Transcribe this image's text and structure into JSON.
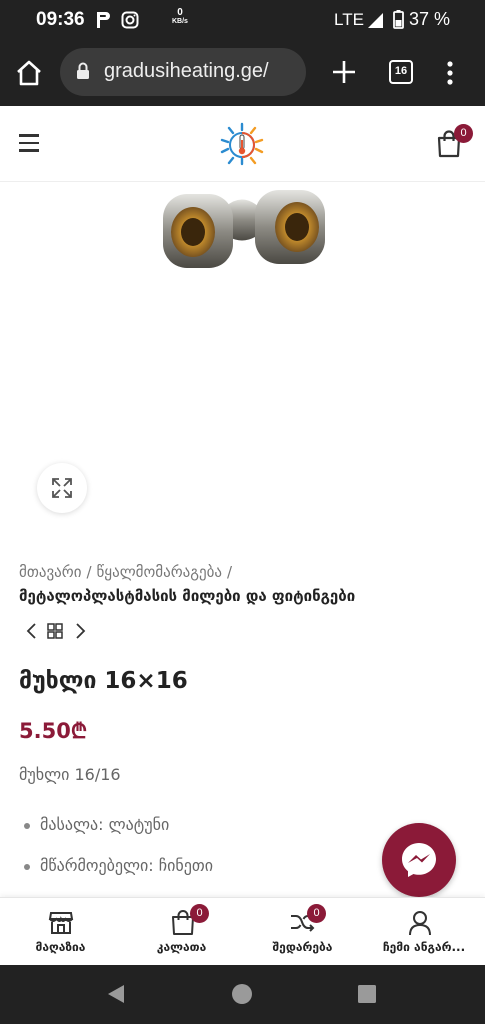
{
  "status_bar": {
    "time": "09:36",
    "net_speed_value": "0",
    "net_speed_unit": "KB/s",
    "network": "LTE",
    "battery_percent": "37 %"
  },
  "browser": {
    "url": "gradusiheating.ge/",
    "tab_count": "16"
  },
  "header": {
    "cart_count": "0"
  },
  "breadcrumb": {
    "home": "მთავარი",
    "separator": "/",
    "section": "წყალმომარაგება",
    "category": "მეტალოპლასტმასის მილები და ფიტინგები"
  },
  "product": {
    "title": "მუხლი 16×16",
    "price": "5.50₾",
    "short_description": "მუხლი 16/16",
    "attributes": [
      "მასალა: ლატუნი",
      "მწარმოებელი: ჩინეთი"
    ]
  },
  "colors": {
    "accent": "#8b1a38",
    "system_bar": "#222222"
  },
  "toolbar": {
    "shop_label": "მაღაზია",
    "cart_label": "კალათა",
    "cart_count": "0",
    "compare_label": "შედარება",
    "compare_count": "0",
    "account_label": "ჩემი ანგარ..."
  }
}
